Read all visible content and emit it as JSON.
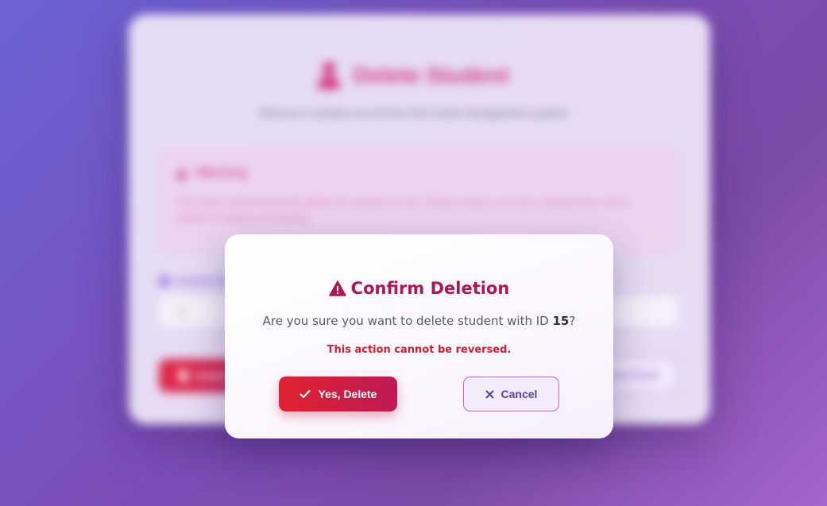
{
  "background_page": {
    "title": "Delete Student",
    "subtitle": "Remove a student record from the hostel management system",
    "warning": {
      "heading": "Warning",
      "text": "This action will permanently delete the student record. Please ensure you have selected the correct student ID before proceeding."
    },
    "student_id_label": "Student ID",
    "student_id_value": "15",
    "delete_button_label": "Delete Student",
    "reset_button_label": "Reset Form"
  },
  "modal": {
    "title": "Confirm Deletion",
    "question_prefix": "Are you sure you want to delete student with ID ",
    "student_id": "15",
    "question_suffix": "?",
    "irreversible_note": "This action cannot be reversed.",
    "confirm_label": "Yes, Delete",
    "cancel_label": "Cancel",
    "icons": {
      "title": "warning-triangle-icon",
      "confirm": "check-icon",
      "cancel": "close-icon"
    }
  },
  "colors": {
    "title": "#b0155a",
    "danger_text": "#d11f35",
    "confirm_gradient_start": "#e2222f",
    "confirm_gradient_end": "#bd1a56",
    "cancel_border": "#b16ae6",
    "cancel_text": "#5a3f9a"
  }
}
